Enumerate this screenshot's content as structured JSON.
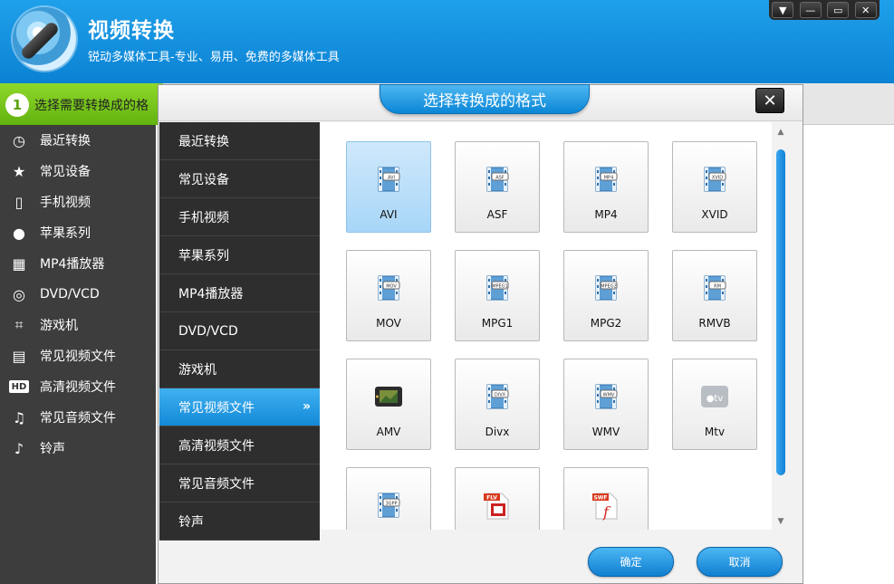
{
  "app": {
    "title": "视频转换",
    "subtitle": "锐动多媒体工具-专业、易用、免费的多媒体工具"
  },
  "window_controls": [
    "▼",
    "—",
    "▭",
    "✕"
  ],
  "step": {
    "number": "1",
    "label": "选择需要转换成的格"
  },
  "sidebar": {
    "items": [
      {
        "label": "最近转换",
        "icon": "clock-icon",
        "glyph": "◷"
      },
      {
        "label": "常见设备",
        "icon": "star-icon",
        "glyph": "★"
      },
      {
        "label": "手机视频",
        "icon": "phone-icon",
        "glyph": "▯"
      },
      {
        "label": "苹果系列",
        "icon": "apple-icon",
        "glyph": "●"
      },
      {
        "label": "MP4播放器",
        "icon": "mp4-player-icon",
        "glyph": "▦"
      },
      {
        "label": "DVD/VCD",
        "icon": "disc-icon",
        "glyph": "◎"
      },
      {
        "label": "游戏机",
        "icon": "gamepad-icon",
        "glyph": "⌗"
      },
      {
        "label": "常见视频文件",
        "icon": "film-icon",
        "glyph": "▤"
      },
      {
        "label": "高清视频文件",
        "icon": "hd-icon",
        "glyph": "HD"
      },
      {
        "label": "常见音频文件",
        "icon": "music-note-icon",
        "glyph": "♫"
      },
      {
        "label": "铃声",
        "icon": "bell-icon",
        "glyph": "♪"
      }
    ]
  },
  "dialog": {
    "title": "选择转换成的格式",
    "close": "✕",
    "categories": [
      {
        "label": "最近转换"
      },
      {
        "label": "常见设备"
      },
      {
        "label": "手机视频"
      },
      {
        "label": "苹果系列"
      },
      {
        "label": "MP4播放器"
      },
      {
        "label": "DVD/VCD"
      },
      {
        "label": "游戏机"
      },
      {
        "label": "常见视频文件",
        "selected": true,
        "chevron": "»"
      },
      {
        "label": "高清视频文件"
      },
      {
        "label": "常见音频文件"
      },
      {
        "label": "铃声"
      }
    ],
    "formats": [
      {
        "label": "AVI",
        "icon": "film-strip-icon",
        "tag": "AVI",
        "selected": true
      },
      {
        "label": "ASF",
        "icon": "film-strip-icon",
        "tag": "ASF"
      },
      {
        "label": "MP4",
        "icon": "film-strip-icon",
        "tag": "MP4"
      },
      {
        "label": "XVID",
        "icon": "film-strip-icon",
        "tag": "XVID"
      },
      {
        "label": "MOV",
        "icon": "film-strip-icon",
        "tag": "MOV"
      },
      {
        "label": "MPG1",
        "icon": "film-strip-icon",
        "tag": "MPEG1"
      },
      {
        "label": "MPG2",
        "icon": "film-strip-icon",
        "tag": "MPEG2"
      },
      {
        "label": "RMVB",
        "icon": "film-strip-icon",
        "tag": "RM"
      },
      {
        "label": "AMV",
        "icon": "amv-player-icon",
        "tag": ""
      },
      {
        "label": "Divx",
        "icon": "film-strip-icon",
        "tag": "DIVX"
      },
      {
        "label": "WMV",
        "icon": "film-strip-icon",
        "tag": "WMV"
      },
      {
        "label": "Mtv",
        "icon": "apple-tv-icon",
        "tag": "tv"
      },
      {
        "label": "",
        "icon": "film-strip-icon",
        "tag": "3GPP"
      },
      {
        "label": "",
        "icon": "flv-file-icon",
        "tag": "FLV"
      },
      {
        "label": "",
        "icon": "swf-file-icon",
        "tag": "SWF"
      }
    ],
    "ok_label": "确定",
    "cancel_label": "取消"
  },
  "colors": {
    "header_blue": "#0b82d3",
    "step_green": "#62b30f",
    "sidebar_dark": "#3d3d3d",
    "selected_blue": "#138ad8"
  }
}
